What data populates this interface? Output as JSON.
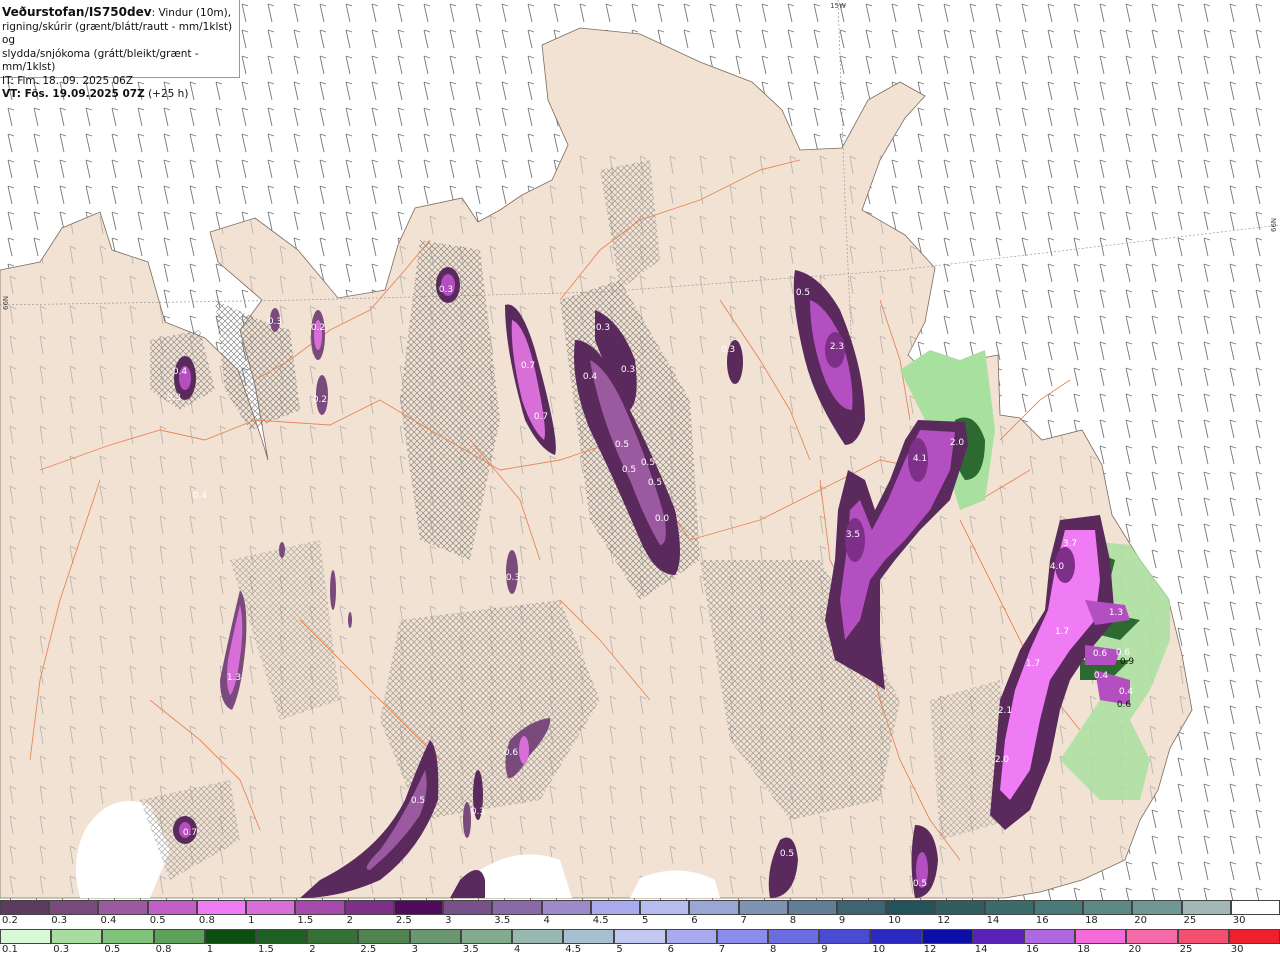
{
  "header": {
    "title_bold": "Veðurstofan/IS750dev",
    "title_rest": ": Vindur (10m),",
    "line2": "rigning/skúrir (grænt/blátt/rautt - mm/1klst) og",
    "line3": "slydda/snjókoma (grátt/bleikt/grænt - mm/1klst)",
    "line4": "IT: Fim. 18. 09. 2025 06Z",
    "line5_bold": "VT: Fös. 19.09.2025 07Z",
    "line5_rest": " (+25 h)"
  },
  "grid_labels": {
    "top": "15W",
    "left": "66N",
    "right": "66N"
  },
  "colors": {
    "sea": "#ffffff",
    "land": "#f1e2d3",
    "roads": "#e8875a",
    "snow": "#b44fc2",
    "snow_dark": "#5b2a5c",
    "rain": "#a8e0a0",
    "rain_dark": "#2d6a2f",
    "hatch": "#666666"
  },
  "map_values": [
    {
      "v": "0.3"
    },
    {
      "v": "0.3"
    },
    {
      "v": "0.2"
    },
    {
      "v": "0.4"
    },
    {
      "v": "0.3"
    },
    {
      "v": "0.7"
    },
    {
      "v": "0.2"
    },
    {
      "v": "0.4"
    },
    {
      "v": "0.3"
    },
    {
      "v": "0.7"
    },
    {
      "v": "0.4"
    },
    {
      "v": "0.3"
    },
    {
      "v": "0.5"
    },
    {
      "v": "0.5"
    },
    {
      "v": "0.5"
    },
    {
      "v": "0.5"
    },
    {
      "v": "0.0"
    },
    {
      "v": "0.5"
    },
    {
      "v": "2.3"
    },
    {
      "v": "2.0"
    },
    {
      "v": "4.1"
    },
    {
      "v": "3.5"
    },
    {
      "v": "3.7"
    },
    {
      "v": "4.0"
    },
    {
      "v": "1.3"
    },
    {
      "v": "1.7"
    },
    {
      "v": "1.7"
    },
    {
      "v": "0.6"
    },
    {
      "v": "0.6"
    },
    {
      "v": "0.9"
    },
    {
      "v": "0.4"
    },
    {
      "v": "0.4"
    },
    {
      "v": "0.6"
    },
    {
      "v": "2.1"
    },
    {
      "v": "2.0"
    },
    {
      "v": "1.3"
    },
    {
      "v": "0.6"
    },
    {
      "v": "0.5"
    },
    {
      "v": "0.3"
    },
    {
      "v": "0.7"
    },
    {
      "v": "0.5"
    },
    {
      "v": "0.5"
    },
    {
      "v": "0.3"
    },
    {
      "v": "0.3"
    }
  ],
  "legend_snow": {
    "labels": [
      "0.2",
      "0.3",
      "0.4",
      "0.5",
      "0.8",
      "1",
      "1.5",
      "2",
      "2.5",
      "3",
      "3.5",
      "4",
      "4.5",
      "5",
      "6",
      "7",
      "8",
      "9",
      "10",
      "12",
      "14",
      "16",
      "18",
      "20",
      "25",
      "30"
    ],
    "colors": [
      "#5d3b5e",
      "#7b4a7d",
      "#9b5aa0",
      "#c35ec8",
      "#f07cf5",
      "#d86fd9",
      "#a64aae",
      "#7e2f87",
      "#520a5c",
      "#78508a",
      "#8a6aa6",
      "#9d8ac8",
      "#aaaaee",
      "#b7bdf0",
      "#9aa7d4",
      "#7f93b4",
      "#627e96",
      "#3d6470",
      "#24525a",
      "#2f5d60",
      "#3b6b6b",
      "#4a7a78",
      "#5c8886",
      "#6f9895",
      "#a3b8b6",
      "#ffffff"
    ]
  },
  "legend_rain": {
    "labels": [
      "0.1",
      "0.3",
      "0.5",
      "0.8",
      "1",
      "1.5",
      "2",
      "2.5",
      "3",
      "3.5",
      "4",
      "4.5",
      "5",
      "6",
      "7",
      "8",
      "9",
      "10",
      "12",
      "14",
      "16",
      "18",
      "20",
      "25",
      "30"
    ],
    "colors": [
      "#d8f8d6",
      "#a7dea0",
      "#7fc47a",
      "#5da15c",
      "#0d4d12",
      "#1f5f24",
      "#357035",
      "#4f8350",
      "#6a9770",
      "#82aa8e",
      "#98b8b0",
      "#a7bfcf",
      "#c2c8f0",
      "#a9a9ef",
      "#8c8cea",
      "#6c6ce0",
      "#4a4ad3",
      "#2a2ac0",
      "#0d0da8",
      "#5a22b8",
      "#b068df",
      "#f36ad9",
      "#f56aa8",
      "#f3506f",
      "#ee2030"
    ]
  }
}
